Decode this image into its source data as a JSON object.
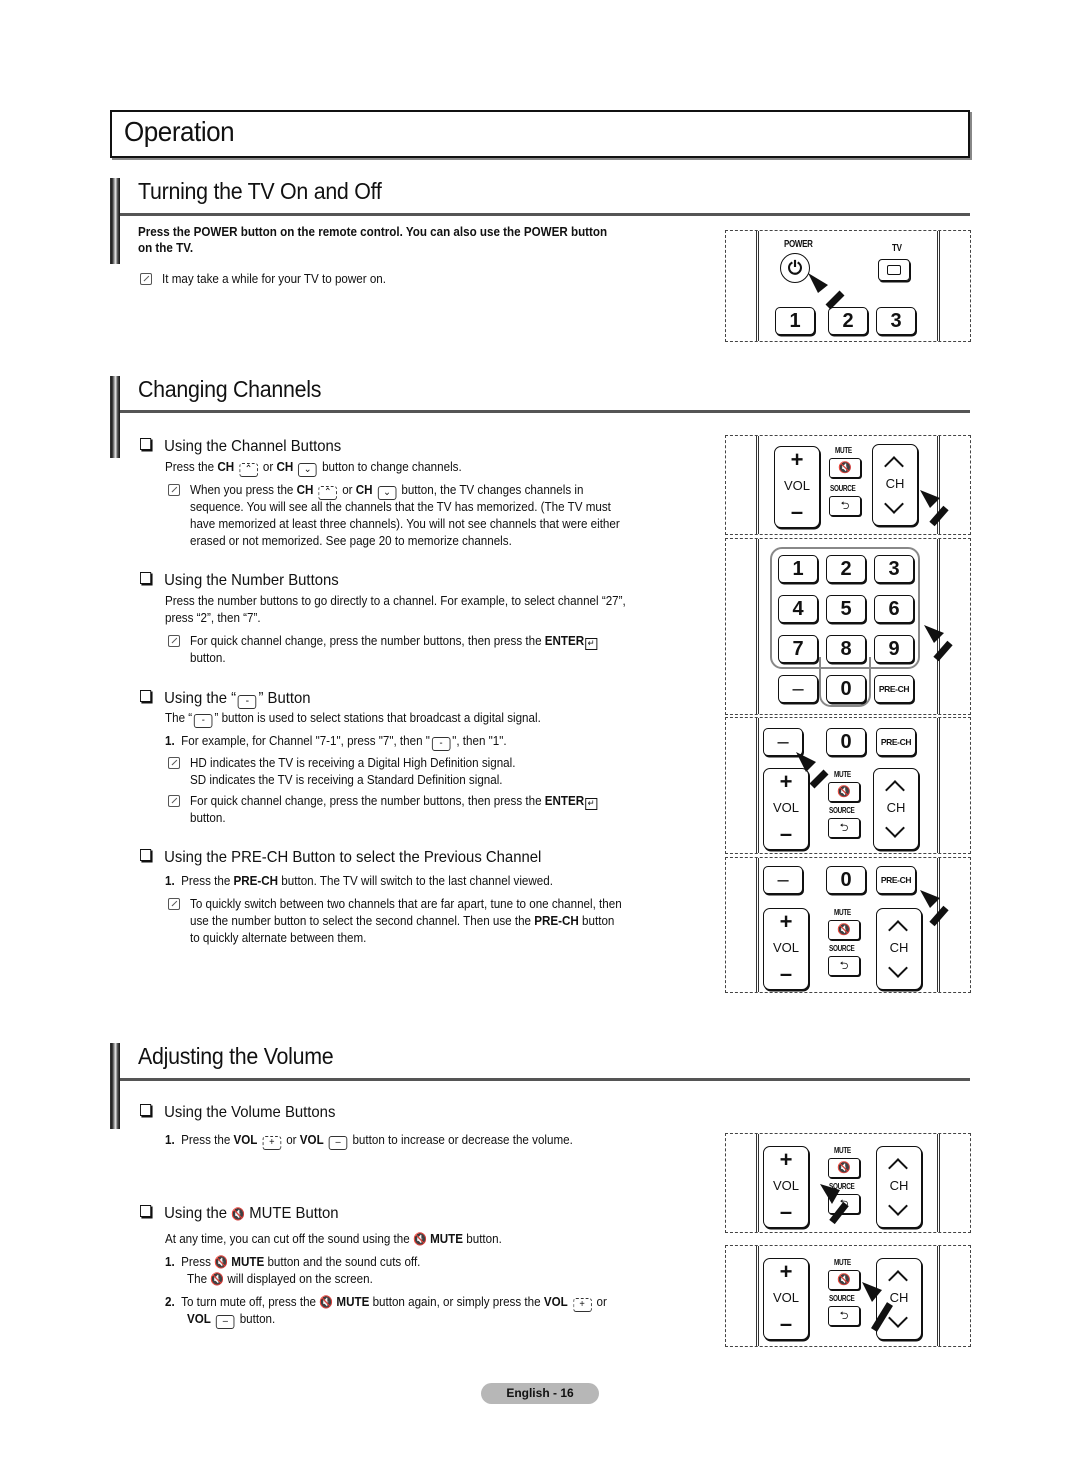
{
  "page": {
    "title": "Operation",
    "footer": "English - 16"
  },
  "sections": {
    "power": {
      "title": "Turning the TV On and Off",
      "intro": "Press the POWER button on the remote control. You can also use the POWER button",
      "intro_2": "on the TV.",
      "note": "It may take a while for your TV to power on."
    },
    "channels": {
      "title": "Changing Channels",
      "channel_buttons": {
        "heading": "Using the Channel Buttons",
        "line_prefix": "Press the ",
        "ch": "CH",
        "or": " or ",
        "line_suffix": " button to change channels.",
        "note_l1_prefix": "When you press the ",
        "note_l1_suffix": " button, the TV changes channels in",
        "note_l2": "sequence. You will see all the channels that the TV has memorized. (The TV must",
        "note_l3": "have memorized at least three channels). You will not see channels that were either",
        "note_l4": "erased or not memorized. See page 20 to memorize channels."
      },
      "number_buttons": {
        "heading": "Using the Number Buttons",
        "body_l1": "Press the number buttons to go directly to a channel. For example, to select channel “27”,",
        "body_l2": "press “2”, then “7”.",
        "note_l1": "For quick channel change, press the number buttons, then press the ",
        "enter": "ENTER",
        "note_l2": "button."
      },
      "dash_button": {
        "heading_prefix": "Using the “",
        "heading_suffix": "” Button",
        "body_prefix": "The “",
        "body_suffix": "” button is used to select stations that broadcast a digital signal.",
        "step1_num": "1.",
        "step1_prefix": "For example, for Channel \"7-1\", press \"7\", then \"",
        "step1_suffix": "\", then \"1\".",
        "note1_l1": "HD indicates the TV is receiving a Digital High Definition signal.",
        "note1_l2": "SD indicates the TV is receiving a Standard Definition signal.",
        "note2_l1": "For quick channel change, press the number buttons, then press the ",
        "enter": "ENTER",
        "note2_l2": "button."
      },
      "prech": {
        "heading": "Using the PRE-CH Button to select the Previous Channel",
        "step1_num": "1.",
        "step1_prefix": "Press the ",
        "step1_bold": "PRE-CH",
        "step1_suffix": " button. The TV will switch to the last channel viewed.",
        "note_l1": "To quickly switch between two channels that are far apart, tune to one channel, then",
        "note_l2_prefix": "use the number button to select the second channel. Then use the ",
        "note_l2_bold": "PRE-CH",
        "note_l2_suffix": " button",
        "note_l3": "to quickly alternate between them."
      }
    },
    "volume": {
      "title": "Adjusting the Volume",
      "vol_buttons": {
        "heading": "Using the Volume Buttons",
        "step1_num": "1.",
        "step1_prefix": "Press the ",
        "vol": "VOL",
        "or": " or ",
        "step1_suffix": " button to increase or decrease the volume."
      },
      "mute": {
        "heading_prefix": "Using the ",
        "heading_suffix": " MUTE Button",
        "body_prefix": "At any time, you can cut off the sound using the ",
        "mute": "MUTE",
        "body_suffix": " button.",
        "step1_num": "1.",
        "step1_prefix": "Press ",
        "step1_suffix": " button and the sound cuts off.",
        "step1_l2_prefix": "The ",
        "step1_l2_suffix": " will displayed on the screen.",
        "step2_num": "2.",
        "step2_prefix": "To turn mute off, press the ",
        "step2_mid": " button again, or simply press the ",
        "vol": "VOL",
        "step2_or": " or",
        "step2_l2_suffix": " button."
      }
    }
  },
  "remote": {
    "power_label": "POWER",
    "tv_label": "TV",
    "power_glyph": "⏻",
    "digits": [
      "1",
      "2",
      "3",
      "4",
      "5",
      "6",
      "7",
      "8",
      "9"
    ],
    "zero": "0",
    "dash": "–",
    "prech": "PRE-CH",
    "vol": "VOL",
    "ch": "CH",
    "mute_label": "MUTE",
    "source_label": "SOURCE",
    "plus": "+",
    "minus": "–",
    "mute_glyph": "🔇",
    "source_glyph": "⮌"
  },
  "glyphs": {
    "up": "⌃",
    "down": "⌄",
    "plus": "+",
    "minus": "–",
    "dash": "-",
    "enter": "↵",
    "mute": "🔇"
  }
}
